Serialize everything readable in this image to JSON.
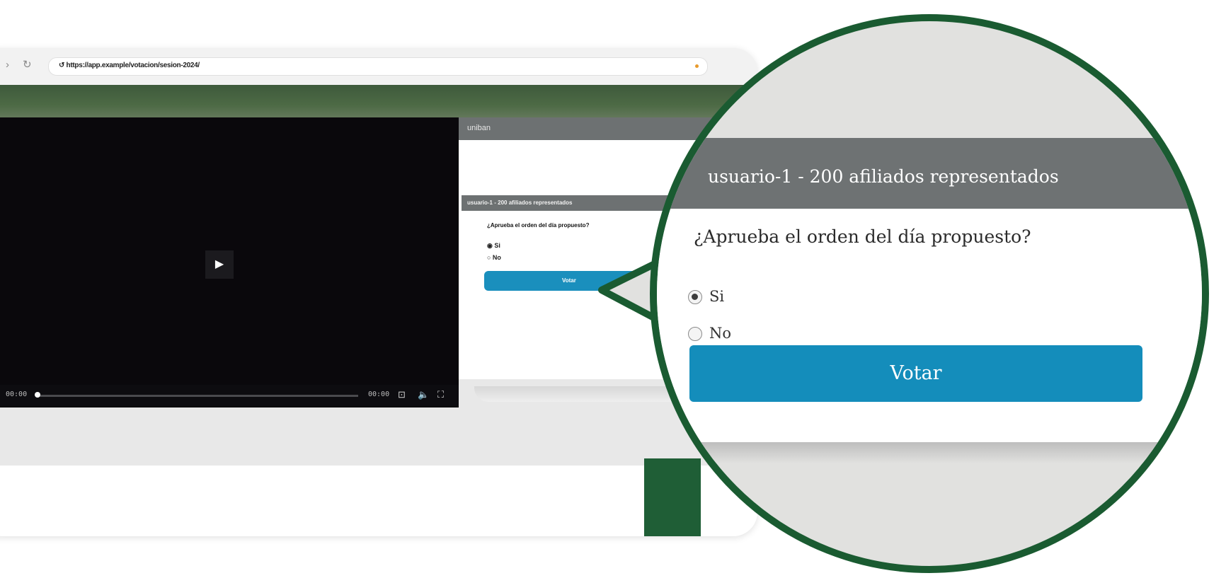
{
  "browser": {
    "url": "↺ https://app.example/votacion/sesion-2024/",
    "nav_back": "›",
    "nav_reload": "↻"
  },
  "video": {
    "play_glyph": "▶",
    "time_current": "00:00",
    "time_total": "00:00",
    "cc_glyph": "⊡",
    "volume_glyph": "🔈",
    "fullscreen_glyph": "⛶",
    "progress": 0.01
  },
  "panel": {
    "title": "uniban",
    "mini_user": "usuario-1 - 200 afiliados representados",
    "mini_question": "¿Aprueba el orden del día propuesto?",
    "mini_option_si": "◉ Si",
    "mini_option_no": "○ No",
    "mini_vote": "Votar"
  },
  "magnifier": {
    "user_line": "usuario-1 - 200 afiliados representados",
    "question": "¿Aprueba el orden del día propuesto?",
    "options": [
      {
        "label": "Si",
        "selected": true
      },
      {
        "label": "No",
        "selected": false
      }
    ],
    "vote_label": "Votar"
  },
  "colors": {
    "accent_blue": "#148dbb",
    "header_gray": "#6e7273",
    "frame_green": "#1a5b31"
  }
}
